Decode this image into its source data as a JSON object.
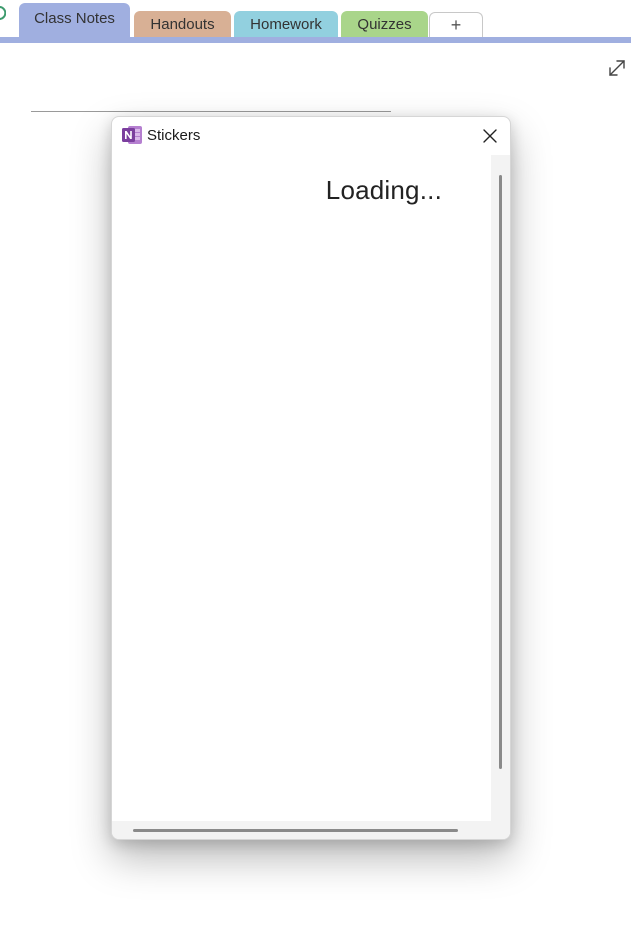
{
  "section_tabs": [
    {
      "label": "Class Notes",
      "color": "#a0afe0",
      "active": true
    },
    {
      "label": "Handouts",
      "color": "#d8b095",
      "active": false
    },
    {
      "label": "Homework",
      "color": "#92d0df",
      "active": false
    },
    {
      "label": "Quizzes",
      "color": "#a9d58a",
      "active": false
    }
  ],
  "add_tab": {
    "label": "+"
  },
  "dialog": {
    "title": "Stickers",
    "loading_text": "Loading..."
  },
  "colors": {
    "accent": "#a0afe0",
    "onenote_purple": "#7b3f9e"
  }
}
